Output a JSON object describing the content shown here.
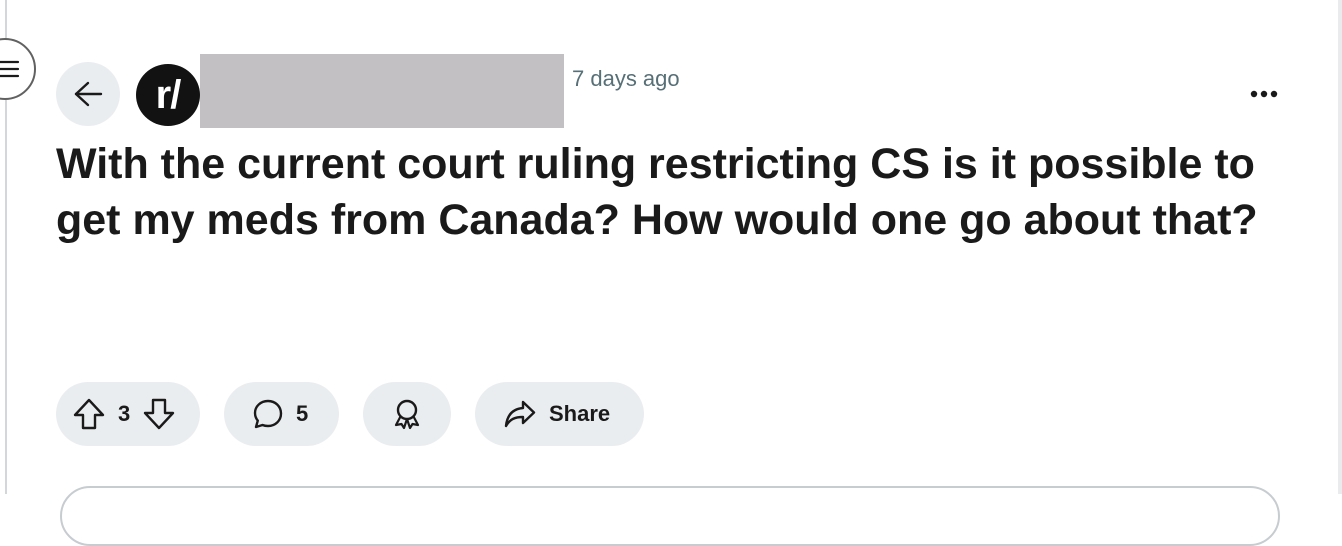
{
  "header": {
    "timestamp": "7 days ago",
    "subreddit_avatar_text": "r/"
  },
  "post": {
    "title": "With the current court ruling restricting CS is it possible to get my meds from Canada? How would one go about that?"
  },
  "actions": {
    "vote_count": "3",
    "comment_count": "5",
    "share_label": "Share"
  },
  "icons": {
    "menu": "hamburger-icon",
    "back": "arrow-left-icon",
    "more": "ellipsis-icon",
    "upvote": "arrow-up-icon",
    "downvote": "arrow-down-icon",
    "comment": "speech-bubble-icon",
    "award": "award-icon",
    "share": "share-arrow-icon"
  },
  "colors": {
    "pill_background": "#eaedef",
    "text_primary": "#1a1a1b",
    "text_meta": "#576f76",
    "redaction": "#c2c0c2",
    "avatar_background": "#121212"
  }
}
